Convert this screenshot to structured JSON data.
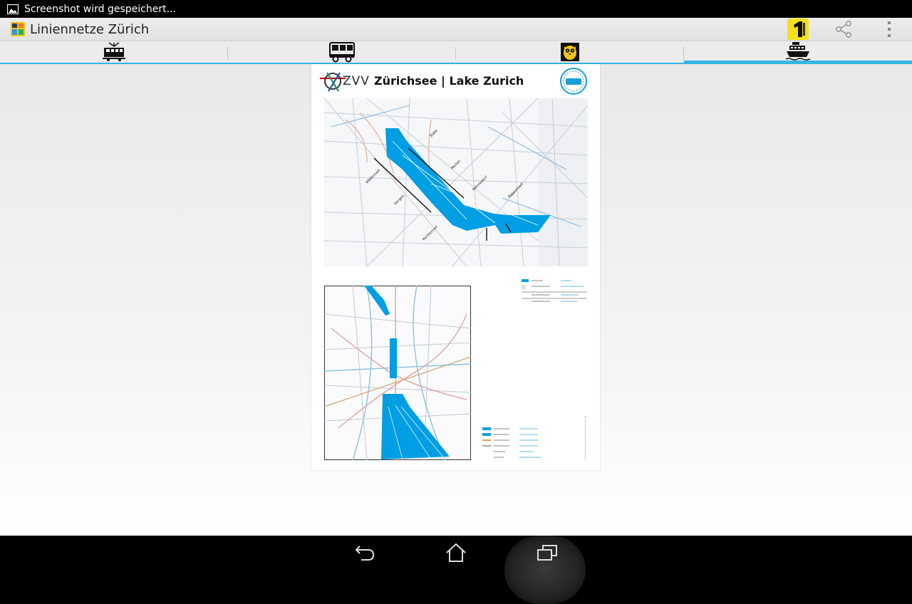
{
  "status_bar": {
    "notification_text": "Screenshot wird gespeichert..."
  },
  "action_bar": {
    "title": "Liniennetze Zürich",
    "icons": [
      "app-logo-icon",
      "number-one-badge-icon",
      "share-icon",
      "overflow-menu-icon"
    ]
  },
  "tabs": [
    {
      "name": "tram",
      "icon": "tram-icon",
      "active": false
    },
    {
      "name": "bus",
      "icon": "bus-icon",
      "active": false
    },
    {
      "name": "night",
      "icon": "owl-icon",
      "active": false
    },
    {
      "name": "boat",
      "icon": "ship-icon",
      "active": true
    }
  ],
  "document": {
    "brand": "ZVV",
    "title": "Zürichsee | Lake Zurich"
  },
  "nav_bar": {
    "buttons": [
      "back-icon",
      "home-icon",
      "recent-apps-icon"
    ]
  },
  "colors": {
    "accent": "#33b5e5",
    "lake": "#009ee3"
  }
}
